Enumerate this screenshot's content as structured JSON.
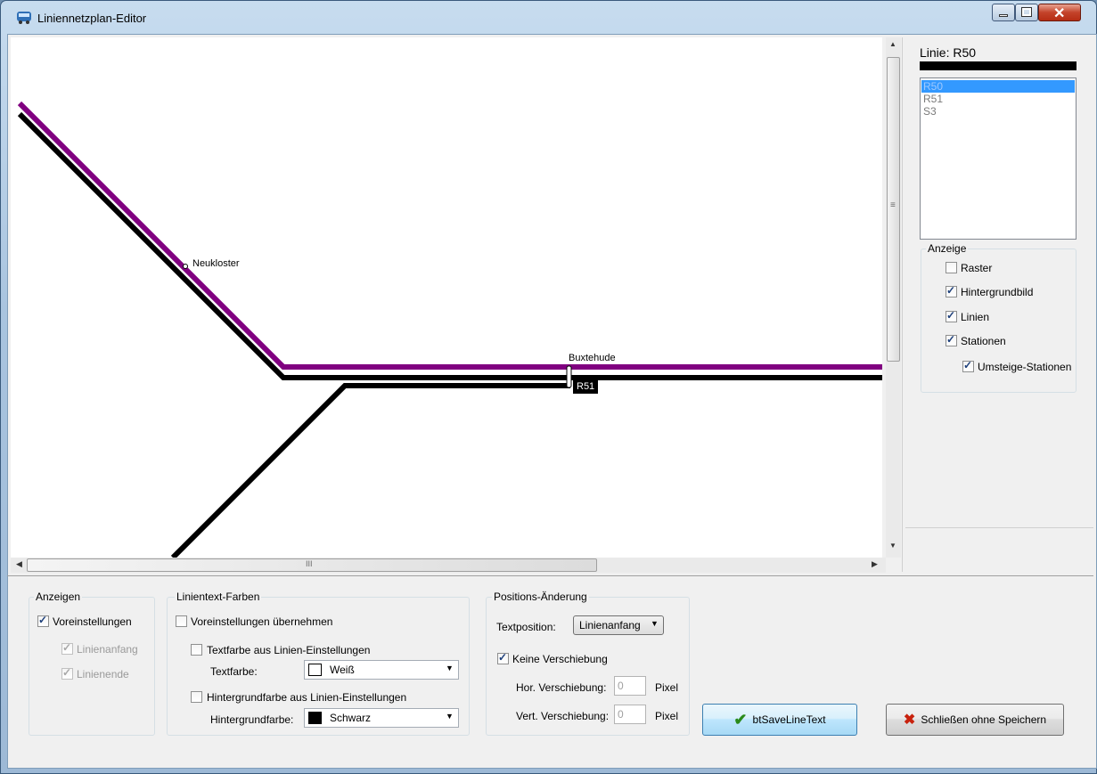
{
  "window": {
    "title": "Liniennetzplan-Editor",
    "minimize_icon": "minimize-icon",
    "maximize_icon": "maximize-icon",
    "close_icon": "close-icon"
  },
  "map": {
    "stations": [
      {
        "name": "Neukloster"
      },
      {
        "name": "Buxtehude"
      }
    ],
    "line_label": "R51",
    "colors": {
      "line_purple": "#800080",
      "line_black": "#000000"
    },
    "hscroll_marker": "III",
    "vscroll_marker": "≡"
  },
  "right_panel": {
    "line_title": "Linie: R50",
    "line_color": "#000000",
    "lines": [
      "R50",
      "R51",
      "S3"
    ],
    "selected_index": 0,
    "display_group": {
      "legend": "Anzeige",
      "items": [
        {
          "label": "Raster",
          "checked": false
        },
        {
          "label": "Hintergrundbild",
          "checked": true
        },
        {
          "label": "Linien",
          "checked": true
        },
        {
          "label": "Stationen",
          "checked": true
        },
        {
          "label": "Umsteige-Stationen",
          "checked": true
        }
      ]
    }
  },
  "bottom": {
    "anzeigen": {
      "legend": "Anzeigen",
      "defaults_label": "Voreinstellungen",
      "start_label": "Linienanfang",
      "end_label": "Linienende"
    },
    "colors": {
      "legend": "Linientext-Farben",
      "apply_defaults": "Voreinstellungen übernehmen",
      "text_color_from_line": "Textfarbe aus Linien-Einstellungen",
      "text_color_label": "Textfarbe:",
      "text_color_value": "Weiß",
      "text_color_swatch": "#ffffff",
      "bg_from_line": "Hintergrundfarbe aus Linien-Einstellungen",
      "bg_color_label": "Hintergrundfarbe:",
      "bg_color_value": "Schwarz",
      "bg_color_swatch": "#000000"
    },
    "position": {
      "legend": "Positions-Änderung",
      "text_position_label": "Textposition:",
      "text_position_value": "Linienanfang",
      "no_shift_label": "Keine Verschiebung",
      "hor_label": "Hor. Verschiebung:",
      "hor_value": "0",
      "hor_unit": "Pixel",
      "vert_label": "Vert. Verschiebung:",
      "vert_value": "0",
      "vert_unit": "Pixel"
    },
    "save_button": "btSaveLineText",
    "close_button": "Schließen ohne Speichern"
  }
}
